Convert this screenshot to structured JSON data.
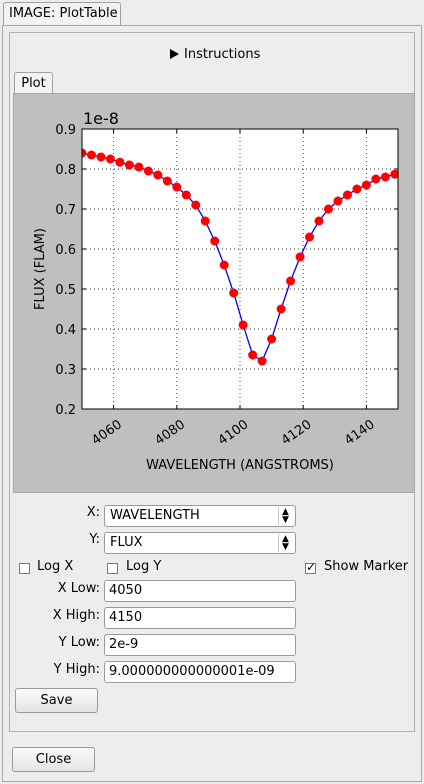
{
  "window": {
    "tab_title": "IMAGE: PlotTable"
  },
  "instructions": {
    "label": "Instructions"
  },
  "plot_tab": {
    "label": "Plot"
  },
  "chart_data": {
    "type": "line",
    "multiplier_label": "1e-8",
    "xlabel": "WAVELENGTH (ANGSTROMS)",
    "ylabel": "FLUX (FLAM)",
    "xlim": [
      4050,
      4150
    ],
    "ylim": [
      0.2,
      0.9
    ],
    "xticks": [
      4060,
      4080,
      4100,
      4120,
      4140
    ],
    "yticks": [
      0.2,
      0.3,
      0.4,
      0.5,
      0.6,
      0.7,
      0.8,
      0.9
    ],
    "grid": true,
    "line_color": "#0000ff",
    "marker_color": "#ff0000",
    "x": [
      4050,
      4053,
      4056,
      4059,
      4062,
      4065,
      4068,
      4071,
      4074,
      4077,
      4080,
      4083,
      4086,
      4089,
      4092,
      4095,
      4098,
      4101,
      4104,
      4107,
      4110,
      4113,
      4116,
      4119,
      4122,
      4125,
      4128,
      4131,
      4134,
      4137,
      4140,
      4143,
      4146,
      4149,
      4152
    ],
    "y": [
      0.84,
      0.835,
      0.83,
      0.825,
      0.817,
      0.81,
      0.805,
      0.795,
      0.785,
      0.77,
      0.755,
      0.735,
      0.71,
      0.67,
      0.62,
      0.56,
      0.49,
      0.41,
      0.335,
      0.32,
      0.375,
      0.45,
      0.52,
      0.58,
      0.63,
      0.67,
      0.7,
      0.72,
      0.735,
      0.75,
      0.76,
      0.775,
      0.78,
      0.787,
      0.79
    ]
  },
  "controls": {
    "x_label": "X:",
    "x_value": "WAVELENGTH",
    "y_label": "Y:",
    "y_value": "FLUX",
    "logx_label": "Log X",
    "logy_label": "Log Y",
    "marker_label": "Show Marker",
    "xlow_label": "X Low:",
    "xlow_value": "4050",
    "xhigh_label": "X High:",
    "xhigh_value": "4150",
    "ylow_label": "Y Low:",
    "ylow_value": "2e-9",
    "yhigh_label": "Y High:",
    "yhigh_value": "9.000000000000001e-09",
    "save_label": "Save",
    "close_label": "Close"
  }
}
